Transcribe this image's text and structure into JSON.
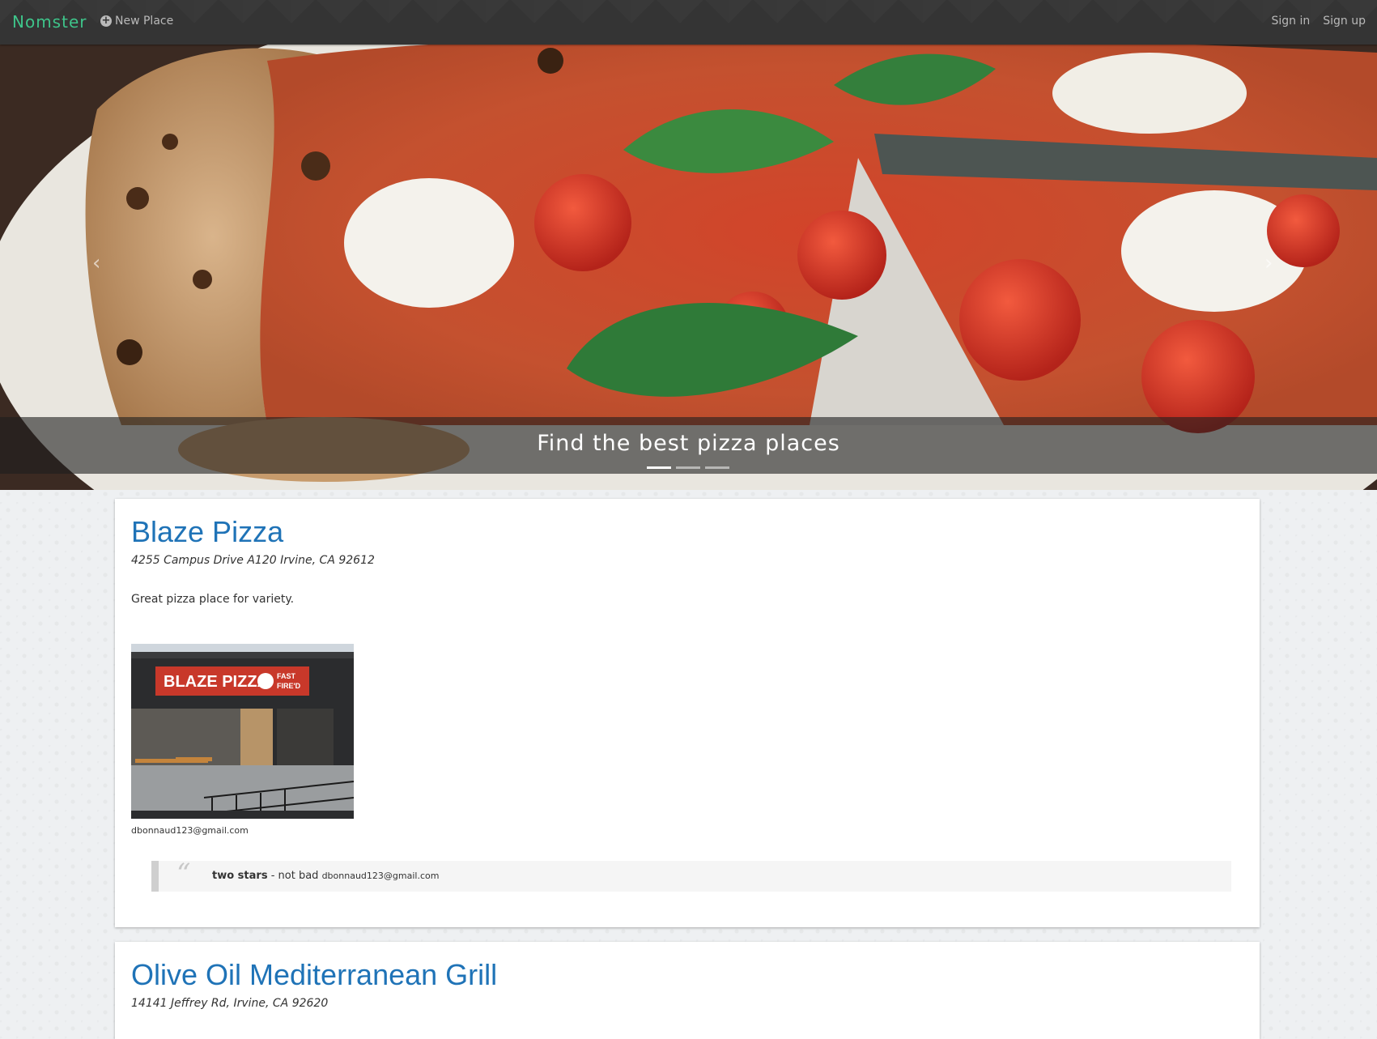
{
  "navbar": {
    "brand": "Nomster",
    "new_place": "New Place",
    "sign_in": "Sign in",
    "sign_up": "Sign up"
  },
  "hero": {
    "caption": "Find the best pizza places",
    "prev_icon": "chevron-left-icon",
    "next_icon": "chevron-right-icon",
    "slide_count": 3,
    "active_slide": 1
  },
  "places": [
    {
      "name": "Blaze Pizza",
      "address": "4255 Campus Drive A120 Irvine, CA 92612",
      "description": "Great pizza place for variety.",
      "photo_sign": "BLAZE PIZZA",
      "photo_tag_1": "FAST",
      "photo_tag_2": "FIRE'D",
      "uploader": "dbonnaud123@gmail.com",
      "review": {
        "rating": "two stars",
        "separator": " - ",
        "text": "not bad",
        "author": "dbonnaud123@gmail.com"
      }
    },
    {
      "name": "Olive Oil Mediterranean Grill",
      "address": "14141 Jeffrey Rd, Irvine, CA 92620"
    }
  ],
  "colors": {
    "brand": "#3ec48a",
    "link": "#1f73b7",
    "navbar_bg": "#343434"
  }
}
